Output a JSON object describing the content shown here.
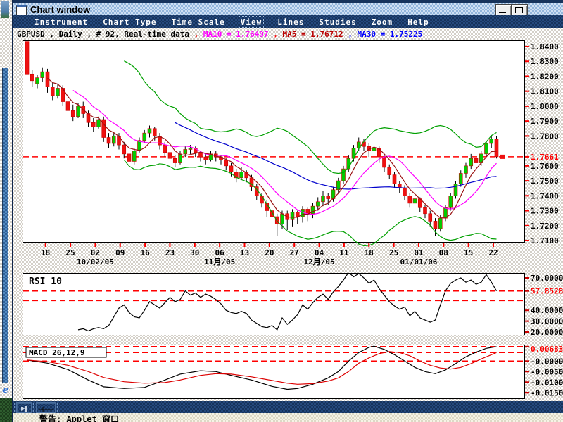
{
  "window": {
    "title": "Chart window"
  },
  "menu": {
    "items": [
      "Instrument",
      "Chart Type",
      "Time Scale",
      "View",
      "Lines",
      "Studies",
      "Zoom",
      "Help"
    ],
    "focused_item": "View"
  },
  "status_line": {
    "segments": [
      {
        "text": "GBPUSD , Daily , # 92, Real-time data ",
        "color": "#000000"
      },
      {
        "text": ", ",
        "color": "#ff0000"
      },
      {
        "text": "MA10 = 1.76497 ",
        "color": "#ff00ff"
      },
      {
        "text": ", ",
        "color": "#ff0000"
      },
      {
        "text": "MA5 = 1.76712 ",
        "color": "#bb0000"
      },
      {
        "text": ", ",
        "color": "#0000ff"
      },
      {
        "text": "MA30 = 1.75225",
        "color": "#0000ff"
      }
    ]
  },
  "bottom_toolbar": {
    "buttons": [
      {
        "name": "flag-tool"
      },
      {
        "name": "trendline-tool"
      }
    ]
  },
  "status_bar": {
    "text": "警告: Applet 窗口"
  },
  "left_strip": {
    "ie_icon_letter": "e"
  },
  "chart_data": [
    {
      "type": "candlestick",
      "title": "GBPUSD Daily",
      "y_axis": {
        "range": [
          1.7086,
          1.8442
        ],
        "labels": [
          {
            "text": "1.8400",
            "value": 1.84
          },
          {
            "text": "1.8300",
            "value": 1.83
          },
          {
            "text": "1.8200",
            "value": 1.82
          },
          {
            "text": "1.8100",
            "value": 1.81
          },
          {
            "text": "1.8000",
            "value": 1.8
          },
          {
            "text": "1.7900",
            "value": 1.79
          },
          {
            "text": "1.7800",
            "value": 1.78
          },
          {
            "text": "1.7661",
            "value": 1.7661,
            "color": "#ff0000"
          },
          {
            "text": "1.7600",
            "value": 1.76
          },
          {
            "text": "1.7500",
            "value": 1.75
          },
          {
            "text": "1.7400",
            "value": 1.74
          },
          {
            "text": "1.7300",
            "value": 1.73
          },
          {
            "text": "1.7200",
            "value": 1.72
          },
          {
            "text": "1.7100",
            "value": 1.71
          }
        ]
      },
      "price_line": {
        "value": 1.7661,
        "color": "#ff0000",
        "style": "dashed"
      },
      "x_axis": {
        "tick_labels": [
          "18",
          "25",
          "02",
          "09",
          "16",
          "23",
          "30",
          "06",
          "13",
          "20",
          "27",
          "04",
          "11",
          "18",
          "25",
          "01",
          "08",
          "15",
          "22"
        ],
        "sub_labels": [
          {
            "text": "10/02/05",
            "tick": 2
          },
          {
            "text": "11月/05",
            "tick": 7
          },
          {
            "text": "12月/05",
            "tick": 11
          },
          {
            "text": "01/01/06",
            "tick": 15
          }
        ]
      },
      "overlays": {
        "ma5_color": "#991111",
        "ma10_color": "#ff00ff",
        "ma30_color": "#0000cc",
        "bollinger_color": "#00a000",
        "bollinger_period": 20,
        "bollinger_stdev": 2,
        "wick_color": "#000000",
        "up_color": "#00cc00",
        "down_color": "#ee1111",
        "body_stroke": "#cc0000"
      },
      "candles": [
        [
          1.843,
          1.844,
          1.814,
          1.8215
        ],
        [
          1.8215,
          1.824,
          1.813,
          1.817
        ],
        [
          1.815,
          1.821,
          1.812,
          1.819
        ],
        [
          1.819,
          1.826,
          1.816,
          1.823
        ],
        [
          1.823,
          1.825,
          1.809,
          1.813
        ],
        [
          1.813,
          1.816,
          1.804,
          1.807
        ],
        [
          1.807,
          1.815,
          1.805,
          1.812
        ],
        [
          1.812,
          1.814,
          1.8,
          1.803
        ],
        [
          1.803,
          1.806,
          1.794,
          1.797
        ],
        [
          1.797,
          1.801,
          1.79,
          1.793
        ],
        [
          1.793,
          1.802,
          1.792,
          1.8
        ],
        [
          1.8,
          1.803,
          1.792,
          1.795
        ],
        [
          1.795,
          1.797,
          1.786,
          1.789
        ],
        [
          1.789,
          1.792,
          1.783,
          1.786
        ],
        [
          1.786,
          1.793,
          1.785,
          1.791
        ],
        [
          1.791,
          1.793,
          1.776,
          1.779
        ],
        [
          1.779,
          1.782,
          1.772,
          1.775
        ],
        [
          1.775,
          1.782,
          1.773,
          1.78
        ],
        [
          1.78,
          1.782,
          1.771,
          1.774
        ],
        [
          1.774,
          1.776,
          1.765,
          1.768
        ],
        [
          1.768,
          1.771,
          1.76,
          1.763
        ],
        [
          1.763,
          1.772,
          1.761,
          1.77
        ],
        [
          1.77,
          1.779,
          1.769,
          1.777
        ],
        [
          1.777,
          1.784,
          1.775,
          1.782
        ],
        [
          1.782,
          1.787,
          1.779,
          1.785
        ],
        [
          1.785,
          1.786,
          1.777,
          1.78
        ],
        [
          1.78,
          1.782,
          1.771,
          1.774
        ],
        [
          1.774,
          1.776,
          1.766,
          1.769
        ],
        [
          1.769,
          1.771,
          1.762,
          1.765
        ],
        [
          1.765,
          1.767,
          1.759,
          1.762
        ],
        [
          1.762,
          1.77,
          1.761,
          1.768
        ],
        [
          1.768,
          1.773,
          1.766,
          1.771
        ],
        [
          1.771,
          1.774,
          1.768,
          1.772
        ],
        [
          1.772,
          1.773,
          1.766,
          1.769
        ],
        [
          1.769,
          1.77,
          1.763,
          1.766
        ],
        [
          1.766,
          1.768,
          1.761,
          1.764
        ],
        [
          1.764,
          1.77,
          1.763,
          1.768
        ],
        [
          1.768,
          1.77,
          1.763,
          1.766
        ],
        [
          1.766,
          1.767,
          1.761,
          1.764
        ],
        [
          1.764,
          1.765,
          1.757,
          1.76
        ],
        [
          1.76,
          1.762,
          1.753,
          1.756
        ],
        [
          1.756,
          1.758,
          1.749,
          1.752
        ],
        [
          1.752,
          1.759,
          1.751,
          1.756
        ],
        [
          1.756,
          1.757,
          1.749,
          1.752
        ],
        [
          1.752,
          1.754,
          1.743,
          1.746
        ],
        [
          1.746,
          1.748,
          1.737,
          1.74
        ],
        [
          1.74,
          1.742,
          1.732,
          1.735
        ],
        [
          1.735,
          1.737,
          1.726,
          1.73
        ],
        [
          1.73,
          1.732,
          1.72,
          1.726
        ],
        [
          1.726,
          1.728,
          1.713,
          1.721
        ],
        [
          1.721,
          1.73,
          1.718,
          1.728
        ],
        [
          1.728,
          1.73,
          1.717,
          1.724
        ],
        [
          1.724,
          1.731,
          1.719,
          1.729
        ],
        [
          1.729,
          1.73,
          1.721,
          1.726
        ],
        [
          1.726,
          1.733,
          1.722,
          1.731
        ],
        [
          1.731,
          1.732,
          1.723,
          1.728
        ],
        [
          1.728,
          1.735,
          1.725,
          1.733
        ],
        [
          1.733,
          1.739,
          1.73,
          1.736
        ],
        [
          1.736,
          1.743,
          1.733,
          1.74
        ],
        [
          1.74,
          1.742,
          1.734,
          1.738
        ],
        [
          1.738,
          1.746,
          1.736,
          1.744
        ],
        [
          1.744,
          1.752,
          1.742,
          1.75
        ],
        [
          1.75,
          1.76,
          1.748,
          1.758
        ],
        [
          1.758,
          1.767,
          1.756,
          1.765
        ],
        [
          1.765,
          1.774,
          1.763,
          1.772
        ],
        [
          1.772,
          1.779,
          1.77,
          1.776
        ],
        [
          1.776,
          1.778,
          1.77,
          1.773
        ],
        [
          1.773,
          1.775,
          1.766,
          1.77
        ],
        [
          1.77,
          1.776,
          1.768,
          1.772
        ],
        [
          1.772,
          1.773,
          1.762,
          1.766
        ],
        [
          1.766,
          1.768,
          1.756,
          1.759
        ],
        [
          1.759,
          1.761,
          1.751,
          1.754
        ],
        [
          1.754,
          1.756,
          1.745,
          1.748
        ],
        [
          1.748,
          1.75,
          1.742,
          1.745
        ],
        [
          1.745,
          1.747,
          1.737,
          1.74
        ],
        [
          1.74,
          1.742,
          1.732,
          1.735
        ],
        [
          1.735,
          1.741,
          1.733,
          1.738
        ],
        [
          1.738,
          1.739,
          1.729,
          1.732
        ],
        [
          1.732,
          1.734,
          1.725,
          1.728
        ],
        [
          1.728,
          1.73,
          1.719,
          1.723
        ],
        [
          1.723,
          1.725,
          1.713,
          1.718
        ],
        [
          1.718,
          1.727,
          1.716,
          1.725
        ],
        [
          1.725,
          1.734,
          1.723,
          1.732
        ],
        [
          1.732,
          1.742,
          1.73,
          1.74
        ],
        [
          1.74,
          1.75,
          1.738,
          1.748
        ],
        [
          1.748,
          1.757,
          1.746,
          1.755
        ],
        [
          1.755,
          1.762,
          1.752,
          1.76
        ],
        [
          1.76,
          1.768,
          1.758,
          1.765
        ],
        [
          1.765,
          1.767,
          1.759,
          1.762
        ],
        [
          1.762,
          1.77,
          1.76,
          1.768
        ],
        [
          1.768,
          1.776,
          1.766,
          1.775
        ],
        [
          1.775,
          1.78,
          1.772,
          1.778
        ],
        [
          1.778,
          1.78,
          1.765,
          1.7661
        ]
      ]
    },
    {
      "type": "line",
      "label": "RSI 10",
      "line_color": "#000000",
      "y_labels": [
        {
          "text": "70.0000",
          "value": 70
        },
        {
          "text": "57.8528",
          "value": 57.8528,
          "color": "#ff0000"
        },
        {
          "text": "40.0000",
          "value": 40
        },
        {
          "text": "30.0000",
          "value": 30
        },
        {
          "text": "20.0000",
          "value": 20
        }
      ],
      "alert_lines": [
        57.8528,
        49
      ],
      "start_index": 10,
      "values": [
        22,
        23,
        21,
        23,
        24,
        23,
        26,
        34,
        42,
        45,
        38,
        34,
        33,
        40,
        48,
        45,
        42,
        47,
        52,
        48,
        50,
        58,
        54,
        56,
        52,
        55,
        53,
        50,
        46,
        40,
        38,
        37,
        39,
        37,
        31,
        28,
        25,
        24,
        26,
        22,
        33,
        27,
        31,
        36,
        45,
        41,
        47,
        52,
        55,
        50,
        57,
        62,
        68,
        75,
        71,
        74,
        70,
        65,
        68,
        60,
        54,
        48,
        44,
        41,
        43,
        35,
        39,
        33,
        31,
        29,
        31,
        45,
        58,
        65,
        68,
        70,
        66,
        68,
        64,
        66,
        73,
        66,
        57.85
      ]
    },
    {
      "type": "line",
      "label": "MACD 26,12,9",
      "y_labels": [
        {
          "text": "0.00683",
          "value": 0.00683,
          "color": "#ff0000"
        },
        {
          "text": "-0.0000",
          "value": 0
        },
        {
          "text": "-0.0050",
          "value": -0.005
        },
        {
          "text": "-0.0100",
          "value": -0.01
        },
        {
          "text": "-0.0150",
          "value": -0.015
        }
      ],
      "alert_lines": [
        0.00683,
        0.004,
        0
      ],
      "series": [
        {
          "name": "macd",
          "color": "#000000",
          "points": [
            [
              0,
              0.0005
            ],
            [
              4,
              -0.001
            ],
            [
              8,
              -0.004
            ],
            [
              12,
              -0.009
            ],
            [
              15,
              -0.0122
            ],
            [
              19,
              -0.013
            ],
            [
              23,
              -0.0125
            ],
            [
              27,
              -0.009
            ],
            [
              30,
              -0.0062
            ],
            [
              34,
              -0.0046
            ],
            [
              37,
              -0.005
            ],
            [
              40,
              -0.0068
            ],
            [
              44,
              -0.009
            ],
            [
              48,
              -0.012
            ],
            [
              51,
              -0.0134
            ],
            [
              53,
              -0.013
            ],
            [
              56,
              -0.011
            ],
            [
              59,
              -0.008
            ],
            [
              61,
              -0.005
            ],
            [
              63,
              0.0
            ],
            [
              65,
              0.004
            ],
            [
              67,
              0.0065
            ],
            [
              68,
              0.007
            ],
            [
              70,
              0.0055
            ],
            [
              72,
              0.003
            ],
            [
              74,
              0.0
            ],
            [
              76,
              -0.003
            ],
            [
              78,
              -0.005
            ],
            [
              80,
              -0.006
            ],
            [
              82,
              -0.0042
            ],
            [
              84,
              -0.0012
            ],
            [
              86,
              0.002
            ],
            [
              88,
              0.0042
            ],
            [
              90,
              0.006
            ],
            [
              92,
              0.0068
            ]
          ]
        },
        {
          "name": "signal",
          "color": "#dd0000",
          "points": [
            [
              0,
              0.0005
            ],
            [
              4,
              -0.0003
            ],
            [
              8,
              -0.002
            ],
            [
              12,
              -0.005
            ],
            [
              15,
              -0.0078
            ],
            [
              19,
              -0.0098
            ],
            [
              23,
              -0.0105
            ],
            [
              27,
              -0.0102
            ],
            [
              30,
              -0.009
            ],
            [
              34,
              -0.0068
            ],
            [
              37,
              -0.006
            ],
            [
              40,
              -0.0062
            ],
            [
              44,
              -0.0075
            ],
            [
              48,
              -0.0092
            ],
            [
              51,
              -0.0105
            ],
            [
              53,
              -0.011
            ],
            [
              56,
              -0.0107
            ],
            [
              59,
              -0.0095
            ],
            [
              61,
              -0.008
            ],
            [
              63,
              -0.005
            ],
            [
              65,
              -0.001
            ],
            [
              67,
              0.0015
            ],
            [
              69,
              0.0035
            ],
            [
              71,
              0.0045
            ],
            [
              73,
              0.004
            ],
            [
              75,
              0.0025
            ],
            [
              77,
              0.0
            ],
            [
              79,
              -0.002
            ],
            [
              81,
              -0.0033
            ],
            [
              83,
              -0.0038
            ],
            [
              85,
              -0.003
            ],
            [
              87,
              -0.0012
            ],
            [
              89,
              0.001
            ],
            [
              91,
              0.003
            ],
            [
              92,
              0.004
            ]
          ]
        }
      ]
    }
  ]
}
